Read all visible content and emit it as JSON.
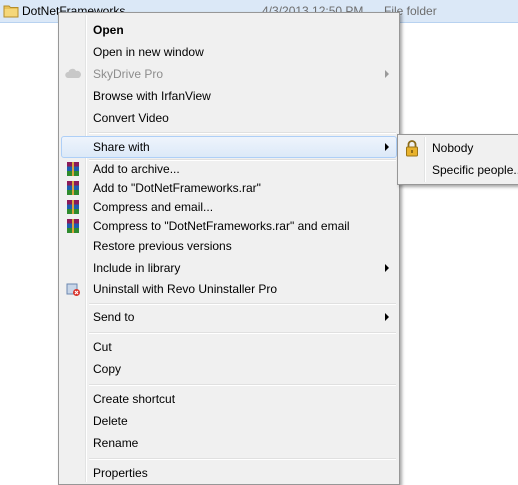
{
  "file_row": {
    "name": "DotNetFrameworks",
    "date": "4/3/2013 12:50 PM",
    "type": "File folder"
  },
  "context_menu": {
    "items": [
      {
        "label": "Open",
        "bold": true
      },
      {
        "label": "Open in new window"
      },
      {
        "label": "SkyDrive Pro",
        "disabled": true,
        "submenu": true,
        "icon": "cloud-icon"
      },
      {
        "label": "Browse with IrfanView"
      },
      {
        "label": "Convert Video"
      },
      {
        "label": "Share with",
        "submenu": true,
        "highlighted": true
      },
      {
        "label": "Add to archive...",
        "icon": "winrar-icon"
      },
      {
        "label": "Add to \"DotNetFrameworks.rar\"",
        "icon": "winrar-icon"
      },
      {
        "label": "Compress and email...",
        "icon": "winrar-icon"
      },
      {
        "label": "Compress to \"DotNetFrameworks.rar\" and email",
        "icon": "winrar-icon"
      },
      {
        "label": "Restore previous versions"
      },
      {
        "label": "Include in library",
        "submenu": true
      },
      {
        "label": "Uninstall with Revo Uninstaller Pro",
        "icon": "revo-uninstaller-icon"
      },
      {
        "label": "Send to",
        "submenu": true
      },
      {
        "label": "Cut"
      },
      {
        "label": "Copy"
      },
      {
        "label": "Create shortcut"
      },
      {
        "label": "Delete"
      },
      {
        "label": "Rename"
      },
      {
        "label": "Properties"
      }
    ]
  },
  "share_submenu": {
    "items": [
      {
        "label": "Nobody",
        "icon": "lock-icon"
      },
      {
        "label": "Specific people..."
      }
    ]
  },
  "colors": {
    "menu_bg": "#f0f0f0",
    "highlight": "#dce9f8",
    "disabled_text": "#8d8d8d"
  }
}
